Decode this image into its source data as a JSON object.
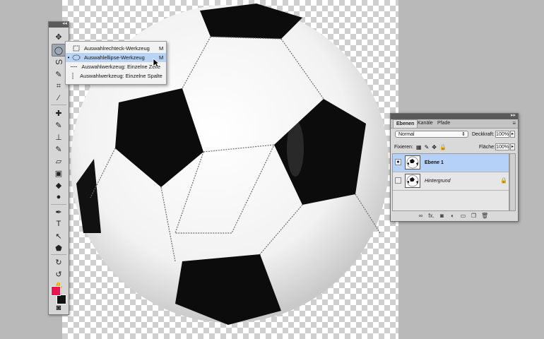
{
  "flyout": {
    "items": [
      {
        "bullet": "",
        "icon": "rectangular-marquee-icon",
        "label": "Auswahlrechteck-Werkzeug",
        "key": "M"
      },
      {
        "bullet": "•",
        "icon": "elliptical-marquee-icon",
        "label": "Auswahlellipse-Werkzeug",
        "key": "M"
      },
      {
        "bullet": "",
        "icon": "single-row-marquee-icon",
        "label": "Auswahlwerkzeug: Einzelne Zeile",
        "key": ""
      },
      {
        "bullet": "",
        "icon": "single-column-marquee-icon",
        "label": "Auswahlwerkzeug: Einzelne Spalte",
        "key": ""
      }
    ]
  },
  "tools": {
    "glyphs": {
      "move": "✥",
      "marquee": "◯",
      "lasso": "ഗ",
      "quick_select": "✎",
      "crop": "⌗",
      "eyedropper": "∕",
      "healing": "✚",
      "brush": "✎",
      "stamp": "⊥",
      "history_brush": "✎",
      "eraser": "▱",
      "gradient": "▣",
      "blur": "◆",
      "dodge": "●",
      "pen": "✒",
      "type": "T",
      "path_select": "↖",
      "shape": "⬟",
      "rotate_3d": "↻",
      "orbit_3d": "↺",
      "hand": "✋",
      "zoom": "⌕",
      "swap": "⇆",
      "quickmask": "◙"
    },
    "foreground_color": "#e8154f",
    "background_color": "#111111"
  },
  "layers": {
    "tabs": [
      "Ebenen",
      "Kanäle",
      "Pfade"
    ],
    "blend_mode": "Normal",
    "opacity_label": "Deckkraft:",
    "opacity_value": "100%",
    "lock_label": "Fixieren:",
    "fill_label": "Fläche:",
    "fill_value": "100%",
    "rows": [
      {
        "name": "Ebene 1",
        "selected": true,
        "visible": true
      },
      {
        "name": "Hintergrund",
        "selected": false,
        "visible": false
      }
    ],
    "bottom_icons": [
      "link-icon",
      "fx-icon",
      "mask-icon",
      "adjustment-icon",
      "group-icon",
      "new-layer-icon",
      "trash-icon"
    ],
    "bottom_glyphs": {
      "link": "∞",
      "fx": "fx.",
      "mask": "◙",
      "adjust": "◐",
      "group": "▭",
      "new": "❐",
      "trash": "🗑"
    }
  }
}
